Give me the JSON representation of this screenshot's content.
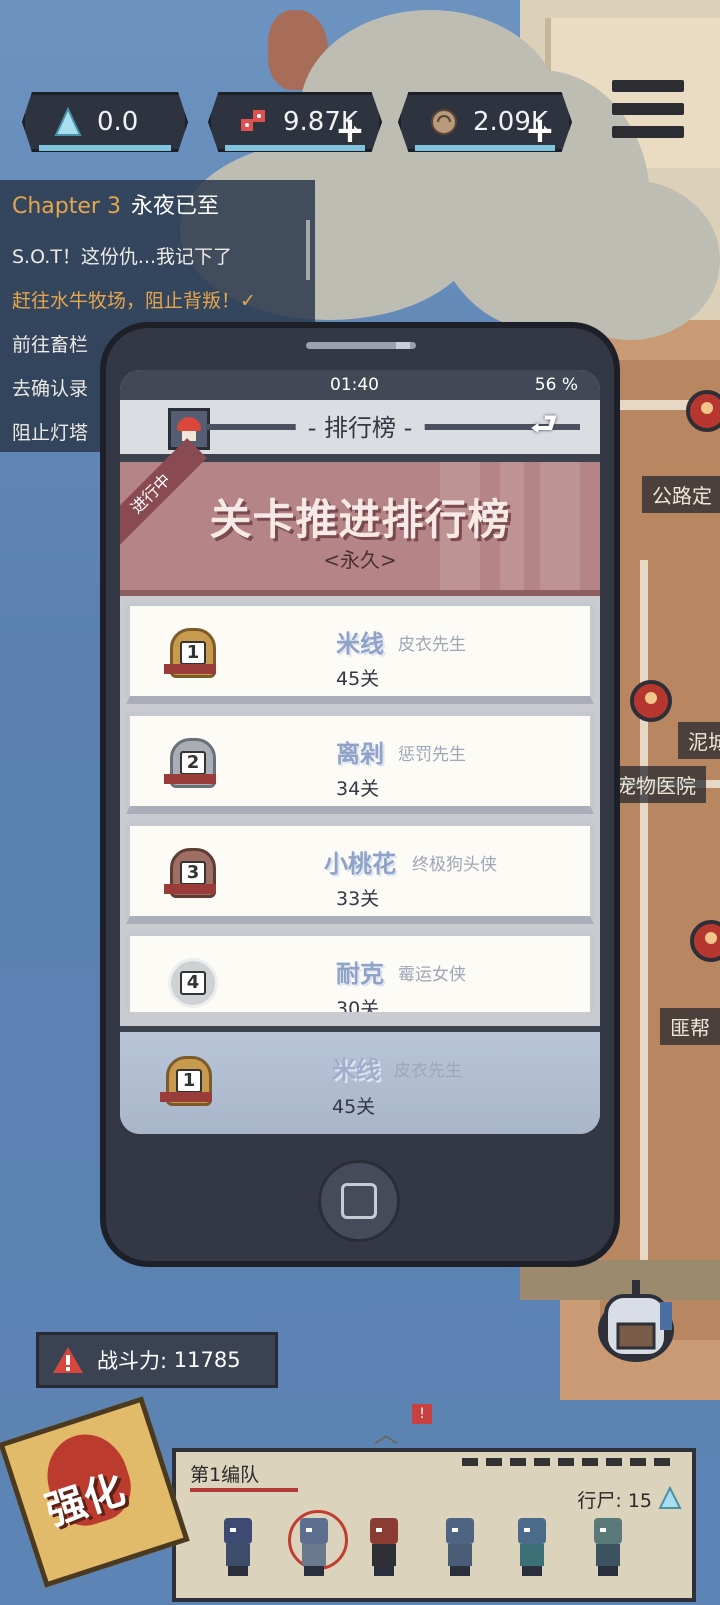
{
  "currencies": [
    {
      "name": "crystal",
      "value": "0.0",
      "icon": "crystal-icon",
      "color": "#9fd7e8",
      "has_plus": false
    },
    {
      "name": "dice",
      "value": "9.87K",
      "icon": "dice-icon",
      "color": "#d64b4b",
      "has_plus": true
    },
    {
      "name": "shell",
      "value": "2.09K",
      "icon": "shell-icon",
      "color": "#b89a7c",
      "has_plus": true
    }
  ],
  "quest": {
    "chapter_label": "Chapter 3",
    "chapter_title": "永夜已至",
    "items": [
      {
        "text": "S.O.T！这份仇...我记下了",
        "active": false
      },
      {
        "text": "赶往水牛牧场，阻止背叛！✓",
        "active": true
      },
      {
        "text": "前往畜栏",
        "active": false
      },
      {
        "text": "去确认录",
        "active": false
      },
      {
        "text": "阻止灯塔",
        "active": false
      }
    ]
  },
  "map_labels": [
    "公路定",
    "泥城",
    "宠物医院",
    "匪帮"
  ],
  "phone": {
    "time": "01:40",
    "battery": "56 %",
    "page_title": "- 排行榜 -",
    "back_icon": "return-arrow-icon",
    "status_ribbon": "进行中",
    "board_title": "关卡推进排行榜",
    "board_subtitle": "<永久>",
    "rankings": [
      {
        "rank": "1",
        "medal": "gold",
        "name": "米线",
        "title": "皮衣先生",
        "stage": "45关"
      },
      {
        "rank": "2",
        "medal": "silver",
        "name": "离剁",
        "title": "惩罚先生",
        "stage": "34关"
      },
      {
        "rank": "3",
        "medal": "bronze",
        "name": "小桃花",
        "title": "终极狗头侠",
        "stage": "33关"
      },
      {
        "rank": "4",
        "medal": "plain",
        "name": "耐克",
        "title": "霉运女侠",
        "stage": "30关"
      }
    ],
    "self": {
      "rank": "1",
      "medal": "gold",
      "name": "米线",
      "title": "皮衣先生",
      "stage": "45关"
    }
  },
  "power": {
    "label": "战斗力:",
    "value": "11785"
  },
  "team": {
    "name": "第1编队",
    "walkers_label": "行尸:",
    "walkers_value": "15",
    "hero_count": 6
  },
  "upgrade_button": "强化",
  "notification_badge": "!"
}
